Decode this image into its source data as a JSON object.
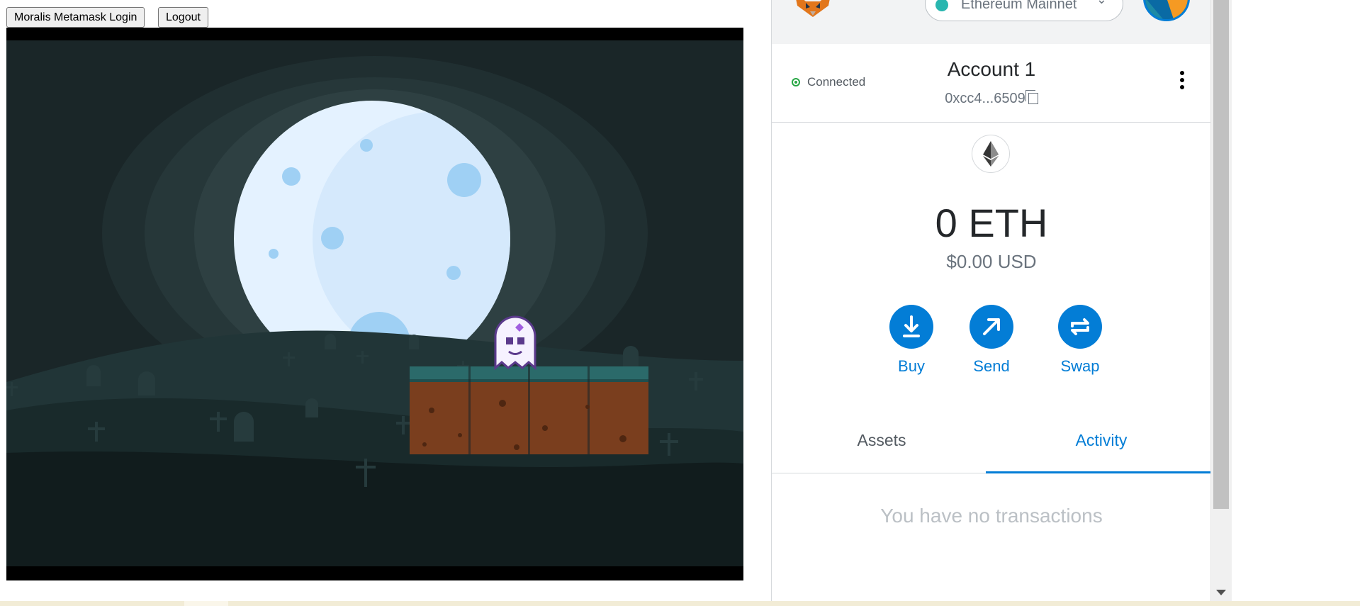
{
  "page_buttons": {
    "login_label": "Moralis Metamask Login",
    "logout_label": "Logout"
  },
  "game": {
    "scene": "night-graveyard",
    "colors": {
      "sky": "#1a2628",
      "moon": "#dceeff",
      "ground": "#0f1a1b",
      "dirt": "#7a3e1e",
      "grass": "#2b6a6a"
    }
  },
  "metamask": {
    "network": "Ethereum Mainnet",
    "connection_status": "Connected",
    "account_name": "Account 1",
    "address_short": "0xcc4...6509",
    "balance": "0 ETH",
    "balance_usd": "$0.00 USD",
    "actions": [
      {
        "label": "Buy",
        "icon": "download-icon"
      },
      {
        "label": "Send",
        "icon": "arrow-up-right-icon"
      },
      {
        "label": "Swap",
        "icon": "swap-arrows-icon"
      }
    ],
    "tabs": [
      {
        "label": "Assets",
        "active": false
      },
      {
        "label": "Activity",
        "active": true
      }
    ],
    "empty_message": "You have no transactions",
    "accent_color": "#037dd6"
  }
}
